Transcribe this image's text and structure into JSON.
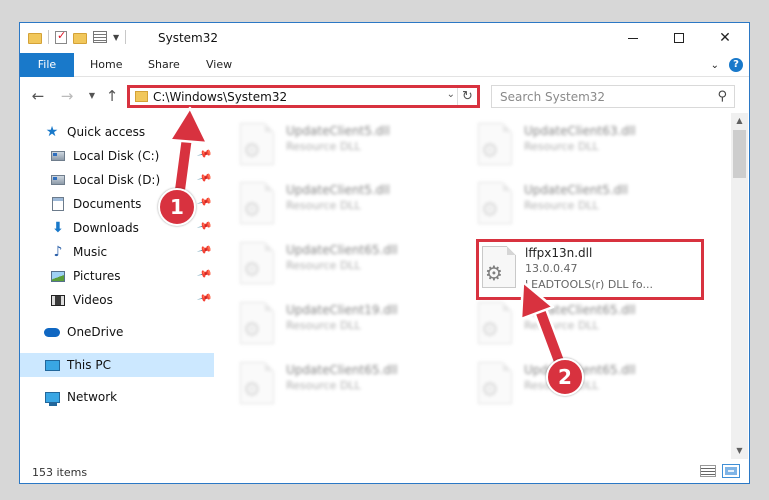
{
  "window": {
    "title": "System32",
    "controls": {
      "minimize": "minimize",
      "maximize": "maximize",
      "close": "close"
    }
  },
  "ribbon": {
    "tabs": [
      "File",
      "Home",
      "Share",
      "View"
    ],
    "active_tab": "File",
    "accent": "#1979ca"
  },
  "nav": {
    "address": "C:\\Windows\\System32",
    "search_placeholder": "Search System32"
  },
  "sidebar": {
    "items": [
      {
        "label": "Quick access",
        "icon": "star-icon",
        "pinned": false
      },
      {
        "label": "Local Disk (C:)",
        "icon": "disk-icon",
        "pinned": true
      },
      {
        "label": "Local Disk (D:)",
        "icon": "disk-icon",
        "pinned": true
      },
      {
        "label": "Documents",
        "icon": "documents-icon",
        "pinned": true
      },
      {
        "label": "Downloads",
        "icon": "downloads-icon",
        "pinned": true
      },
      {
        "label": "Music",
        "icon": "music-icon",
        "pinned": true
      },
      {
        "label": "Pictures",
        "icon": "pictures-icon",
        "pinned": true
      },
      {
        "label": "Videos",
        "icon": "videos-icon",
        "pinned": true
      },
      {
        "label": "OneDrive",
        "icon": "onedrive-icon",
        "pinned": false
      },
      {
        "label": "This PC",
        "icon": "this-pc-icon",
        "pinned": false,
        "selected": true
      },
      {
        "label": "Network",
        "icon": "network-icon",
        "pinned": false
      }
    ]
  },
  "files": [
    {
      "name": "UpdateClient5.dll",
      "desc": "Resource DLL"
    },
    {
      "name": "UpdateClient63.dll",
      "desc": "Resource DLL"
    },
    {
      "name": "UpdateClient5.dll",
      "desc": "Resource DLL"
    },
    {
      "name": "UpdateClient5.dll",
      "desc": "Resource DLL"
    },
    {
      "name": "UpdateClient65.dll",
      "desc": "Resource DLL"
    },
    {
      "name": "lffpx13n.dll",
      "version": "13.0.0.47",
      "desc": "LEADTOOLS(r) DLL fo...",
      "highlighted": true
    },
    {
      "name": "UpdateClient19.dll",
      "desc": "Resource DLL"
    },
    {
      "name": "UpdateClient65.dll",
      "desc": "Resource DLL"
    },
    {
      "name": "UpdateClient65.dll",
      "desc": "Resource DLL"
    },
    {
      "name": "UpdateClient65.dll",
      "desc": "Resource DLL"
    }
  ],
  "status": {
    "item_count": "153 items"
  },
  "annotations": {
    "step1": "1",
    "step2": "2",
    "color": "#d8323f"
  }
}
